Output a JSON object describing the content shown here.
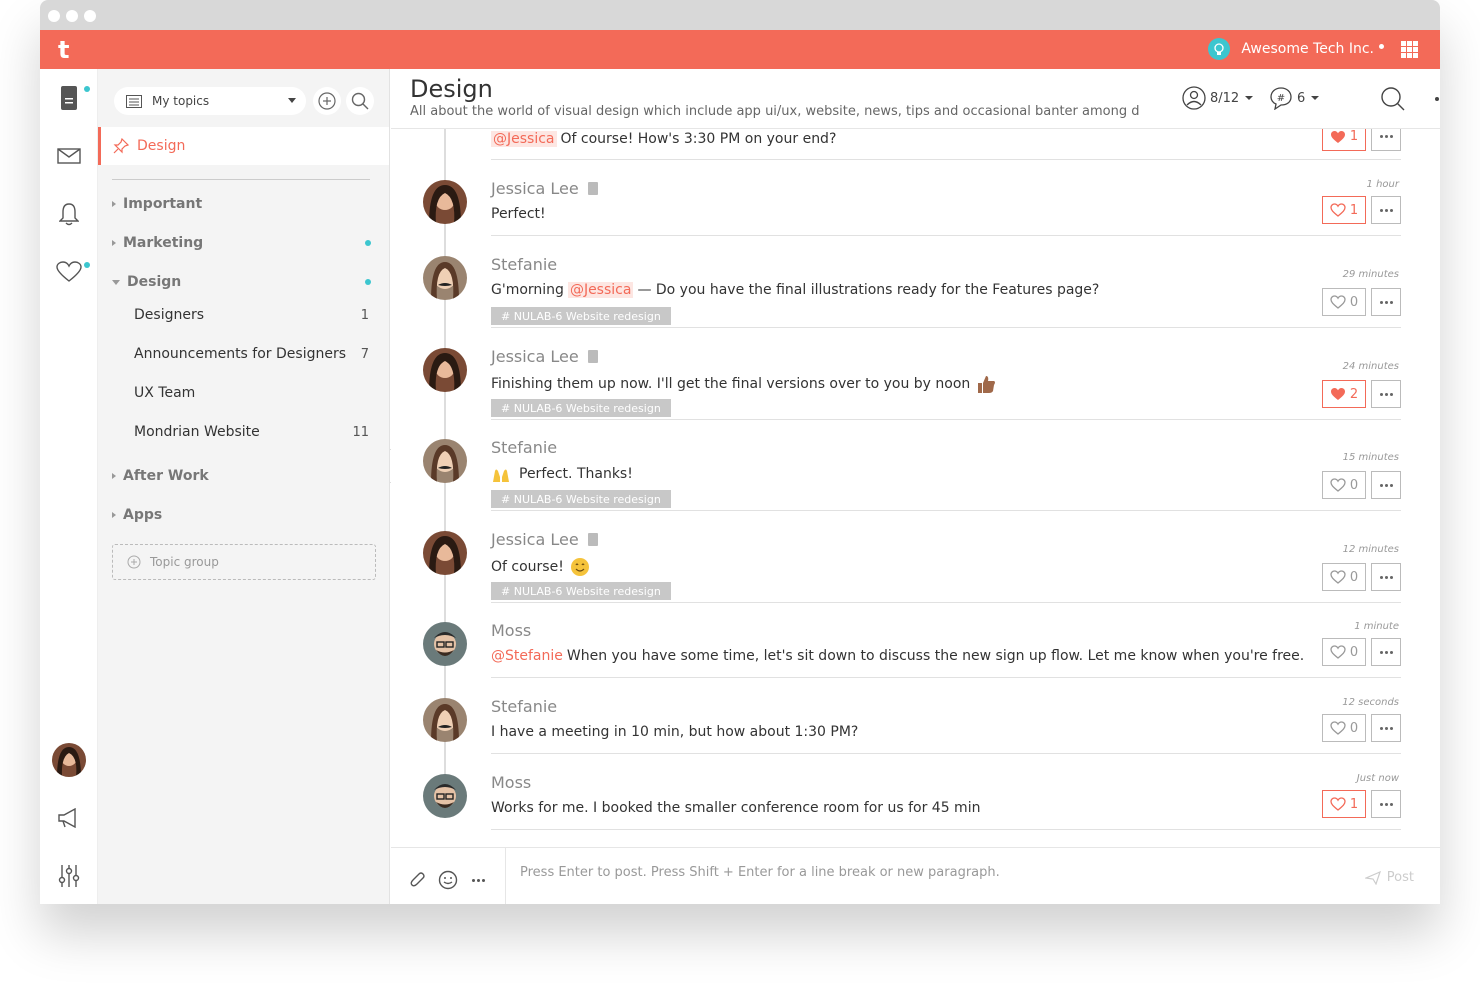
{
  "app": {
    "logo": "t",
    "org_name": "Awesome Tech Inc."
  },
  "sidebar": {
    "topic_select": "My topics",
    "active_topic": "Design",
    "groups": [
      {
        "label": "Important",
        "has_dot": false
      },
      {
        "label": "Marketing",
        "has_dot": true
      },
      {
        "label": "Design",
        "has_dot": true,
        "open": true
      }
    ],
    "subtopics": [
      {
        "label": "Designers",
        "count": "1"
      },
      {
        "label": "Announcements for Designers",
        "count": "7"
      },
      {
        "label": "UX Team",
        "count": ""
      },
      {
        "label": "Mondrian Website",
        "count": "11"
      }
    ],
    "after_work": "After Work",
    "apps": "Apps",
    "topic_group": "Topic group"
  },
  "header": {
    "title": "Design",
    "description": "All about the world of visual design which include app ui/ux, website, news, tips and occasional banter among d",
    "members": "8/12",
    "threads": "6"
  },
  "messages": [
    {
      "author": "",
      "mention": "@Jessica",
      "text": "Of course! How's 3:30 PM on your end?",
      "time": "",
      "likes": "1",
      "liked": true,
      "tag": ""
    },
    {
      "author": "Jessica Lee",
      "mention": "",
      "text": "Perfect!",
      "time": "1 hour",
      "likes": "1",
      "liked": true,
      "tag": ""
    },
    {
      "author": "Stefanie",
      "pre": "G'morning",
      "mention": "@Jessica",
      "text": "— Do you have the final illustrations ready for the Features page?",
      "time": "29 minutes",
      "likes": "0",
      "liked": false,
      "tag": "# NULAB-6 Website redesign"
    },
    {
      "author": "Jessica Lee",
      "mention": "",
      "text": "Finishing them up now. I'll get the final versions over to you by noon",
      "time": "24 minutes",
      "likes": "2",
      "liked": true,
      "tag": "# NULAB-6 Website redesign"
    },
    {
      "author": "Stefanie",
      "mention": "",
      "text": "Perfect. Thanks!",
      "time": "15 minutes",
      "likes": "0",
      "liked": false,
      "tag": "# NULAB-6 Website redesign"
    },
    {
      "author": "Jessica Lee",
      "mention": "",
      "text": "Of course!",
      "time": "12 minutes",
      "likes": "0",
      "liked": false,
      "tag": "# NULAB-6 Website redesign"
    },
    {
      "author": "Moss",
      "mention": "@Stefanie",
      "text": "When you have some time, let's sit down to discuss the new sign up flow. Let me know when you're free.",
      "time": "1 minute",
      "likes": "0",
      "liked": false,
      "tag": ""
    },
    {
      "author": "Stefanie",
      "mention": "",
      "text": "I have a meeting in 10 min, but how about 1:30 PM?",
      "time": "12 seconds",
      "likes": "0",
      "liked": false,
      "tag": ""
    },
    {
      "author": "Moss",
      "mention": "",
      "text": "Works for me. I booked the smaller conference room for us for 45 min",
      "time": "Just now",
      "likes": "1",
      "liked": true,
      "tag": ""
    }
  ],
  "composer": {
    "placeholder": "Press Enter to post. Press Shift + Enter for a line break or new paragraph.",
    "post_label": "Post"
  },
  "colors": {
    "accent": "#f36a58",
    "teal": "#3cc6cf"
  }
}
